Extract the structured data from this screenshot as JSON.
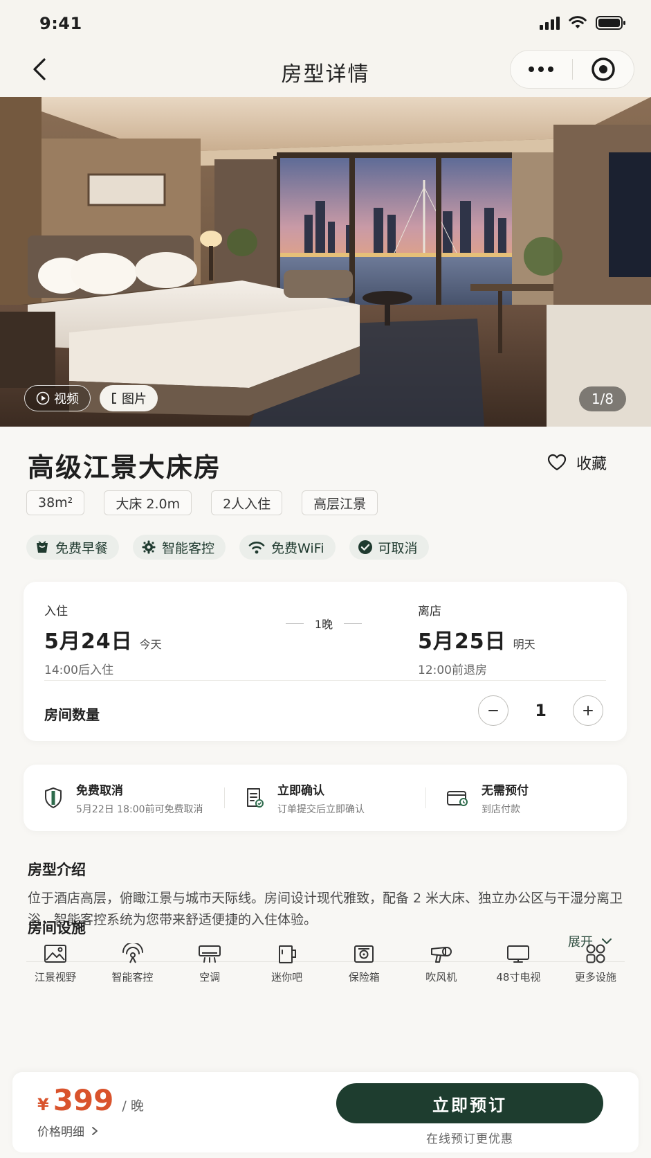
{
  "status_bar": {
    "time": "9:41"
  },
  "nav": {
    "title": "房型详情"
  },
  "gallery": {
    "video_label": "视频",
    "photo_label": "图片",
    "counter": "1/8"
  },
  "room": {
    "title": "高级江景大床房",
    "favorite_label": "收藏",
    "tags": [
      "38m²",
      "大床 2.0m",
      "2人入住",
      "高层江景"
    ],
    "amenity_badges": [
      {
        "icon": "coffee-cup-icon",
        "label": "免费早餐"
      },
      {
        "icon": "smart-control-icon",
        "label": "智能客控"
      },
      {
        "icon": "wifi-icon",
        "label": "免费WiFi"
      },
      {
        "icon": "check-circle-icon",
        "label": "可取消"
      }
    ]
  },
  "stay": {
    "checkin_label": "入住",
    "checkin_date": "5月24日",
    "checkin_rel": "今天",
    "checkin_note": "14:00后入住",
    "nights": "1晚",
    "checkout_label": "离店",
    "checkout_date": "5月25日",
    "checkout_rel": "明天",
    "checkout_note": "12:00前退房",
    "room_count_label": "房间数量",
    "room_count": "1"
  },
  "policies": [
    {
      "icon": "shield-icon",
      "title": "免费取消",
      "sub": "5月22日 18:00前可免费取消"
    },
    {
      "icon": "document-icon",
      "title": "立即确认",
      "sub": "订单提交后立即确认"
    },
    {
      "icon": "wallet-icon",
      "title": "无需预付",
      "sub": "到店付款"
    }
  ],
  "intro": {
    "title": "房型介绍",
    "text": "位于酒店高层，俯瞰江景与城市天际线。房间设计现代雅致，配备 2 米大床、独立办公区与干湿分离卫浴，智能客控系统为您带来舒适便捷的入住体验。",
    "expand_label": "展开"
  },
  "facilities": {
    "title": "房间设施",
    "items": [
      {
        "icon": "landscape-icon",
        "label": "江景视野"
      },
      {
        "icon": "smart-control-icon",
        "label": "智能客控"
      },
      {
        "icon": "air-conditioner-icon",
        "label": "空调"
      },
      {
        "icon": "minibar-icon",
        "label": "迷你吧"
      },
      {
        "icon": "safe-box-icon",
        "label": "保险箱"
      },
      {
        "icon": "hair-dryer-icon",
        "label": "吹风机"
      },
      {
        "icon": "tv-icon",
        "label": "48寸电视"
      },
      {
        "icon": "grid-more-icon",
        "label": "更多设施"
      }
    ]
  },
  "booking": {
    "currency": "¥",
    "price": "399",
    "unit": "/ 晚",
    "price_detail_label": "价格明细",
    "book_label": "立即预订",
    "book_sub": "在线预订更优惠"
  },
  "colors": {
    "brand_green": "#1e3d2f",
    "price_orange": "#d9532c",
    "badge_bg": "#ebeeea",
    "page_bg": "#f8f7f4"
  }
}
